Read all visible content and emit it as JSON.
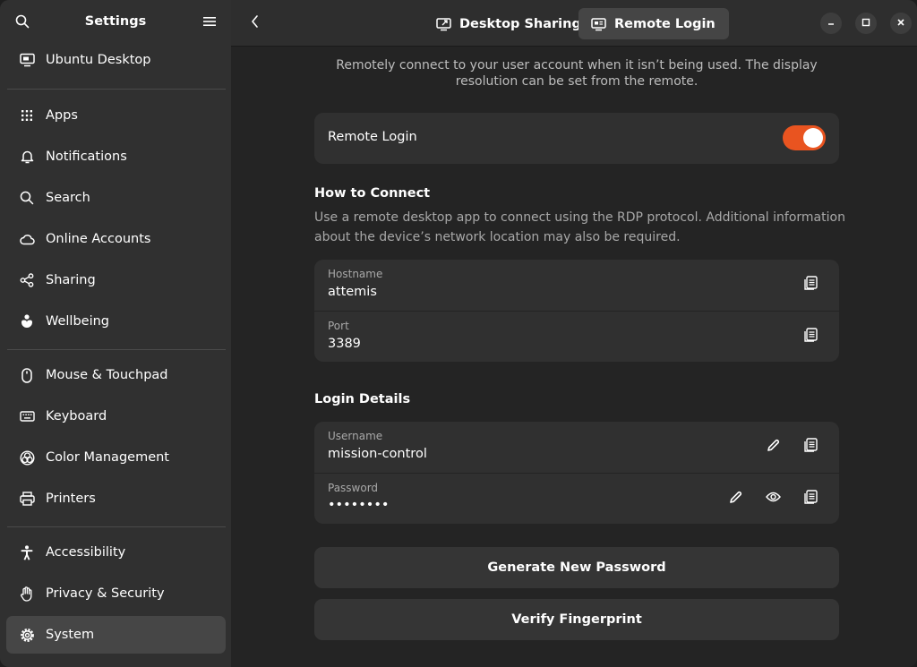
{
  "sidebar": {
    "title": "Settings",
    "items": [
      {
        "label": "Ubuntu Desktop",
        "icon": "desktop-icon"
      },
      {
        "label": "Apps",
        "icon": "apps-grid-icon"
      },
      {
        "label": "Notifications",
        "icon": "bell-icon"
      },
      {
        "label": "Search",
        "icon": "search-icon"
      },
      {
        "label": "Online Accounts",
        "icon": "cloud-icon"
      },
      {
        "label": "Sharing",
        "icon": "share-icon"
      },
      {
        "label": "Wellbeing",
        "icon": "wellbeing-icon"
      },
      {
        "label": "Mouse & Touchpad",
        "icon": "mouse-icon"
      },
      {
        "label": "Keyboard",
        "icon": "keyboard-icon"
      },
      {
        "label": "Color Management",
        "icon": "color-icon"
      },
      {
        "label": "Printers",
        "icon": "printer-icon"
      },
      {
        "label": "Accessibility",
        "icon": "accessibility-icon"
      },
      {
        "label": "Privacy & Security",
        "icon": "hand-icon"
      },
      {
        "label": "System",
        "icon": "gear-icon"
      }
    ]
  },
  "header": {
    "tabs": [
      {
        "label": "Desktop Sharing",
        "active": false
      },
      {
        "label": "Remote Login",
        "active": true
      }
    ]
  },
  "main": {
    "description": "Remotely connect to your user account when it isn’t being used. The display resolution can be set from the remote.",
    "remote_login": {
      "label": "Remote Login",
      "enabled": true
    },
    "how_to_connect": {
      "title": "How to Connect",
      "description": "Use a remote desktop app to connect using the RDP protocol. Additional information about the device’s network location may also be required.",
      "hostname_label": "Hostname",
      "hostname_value": "attemis",
      "port_label": "Port",
      "port_value": "3389"
    },
    "login_details": {
      "title": "Login Details",
      "username_label": "Username",
      "username_value": "mission-control",
      "password_label": "Password",
      "password_value": "••••••••"
    },
    "generate_button": "Generate New Password",
    "verify_button": "Verify Fingerprint"
  },
  "colors": {
    "accent": "#e95420",
    "sidebar_bg": "#303030",
    "main_bg": "#242424",
    "card_bg": "#303030"
  }
}
